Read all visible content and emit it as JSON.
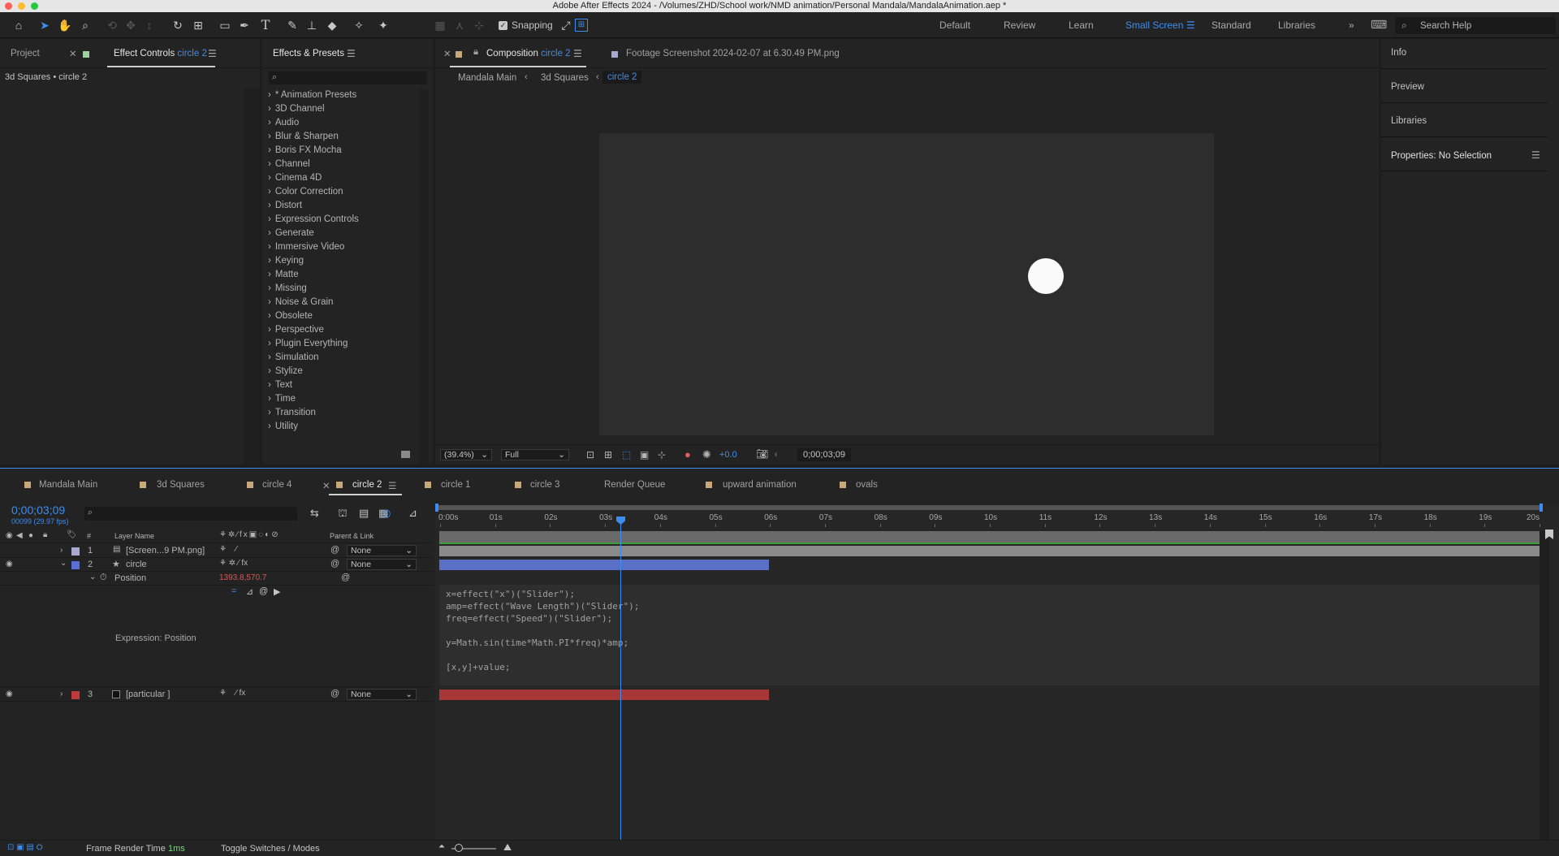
{
  "window": {
    "title": "Adobe After Effects 2024 - /Volumes/ZHD/School work/NMD animation/Personal Mandala/MandalaAnimation.aep *"
  },
  "toolbar": {
    "snapping_label": "Snapping",
    "workspaces": [
      "Default",
      "Review",
      "Learn",
      "Small Screen",
      "Standard",
      "Libraries"
    ],
    "active_workspace": "Small Screen",
    "search_help_placeholder": "Search Help"
  },
  "project_panel": {
    "tab": "Project"
  },
  "effect_controls": {
    "tab_label": "Effect Controls",
    "tab_layer": "circle 2",
    "subtitle": "3d Squares • circle 2"
  },
  "effects_presets": {
    "tab": "Effects & Presets",
    "search_placeholder": "",
    "items": [
      "* Animation Presets",
      "3D Channel",
      "Audio",
      "Blur & Sharpen",
      "Boris FX Mocha",
      "Channel",
      "Cinema 4D",
      "Color Correction",
      "Distort",
      "Expression Controls",
      "Generate",
      "Immersive Video",
      "Keying",
      "Matte",
      "Missing",
      "Noise & Grain",
      "Obsolete",
      "Perspective",
      "Plugin Everything",
      "Simulation",
      "Stylize",
      "Text",
      "Time",
      "Transition",
      "Utility"
    ]
  },
  "composition": {
    "tab_label": "Composition",
    "tab_comp": "circle 2",
    "footage_tab": "Footage Screenshot 2024-02-07 at 6.30.49 PM.png",
    "breadcrumbs": [
      "Mandala Main",
      "3d Squares",
      "circle 2"
    ],
    "zoom": "(39.4%)",
    "resolution": "Full",
    "exposure": "+0.0",
    "timecode": "0;00;03;09"
  },
  "right_panels": {
    "info": "Info",
    "preview": "Preview",
    "libraries": "Libraries",
    "properties": "Properties: No Selection"
  },
  "timeline": {
    "tabs": [
      "Mandala Main",
      "3d Squares",
      "circle 4",
      "circle 2",
      "circle 1",
      "circle 3",
      "Render Queue",
      "upward animation",
      "ovals"
    ],
    "active_tab": "circle 2",
    "current_time": "0;00;03;09",
    "frame_info": "00099 (29.97 fps)",
    "columns": {
      "num": "#",
      "layer_name": "Layer Name",
      "parent": "Parent & Link"
    },
    "ruler": [
      "0:00s",
      "01s",
      "02s",
      "03s",
      "04s",
      "05s",
      "06s",
      "07s",
      "08s",
      "09s",
      "10s",
      "11s",
      "12s",
      "13s",
      "14s",
      "15s",
      "16s",
      "17s",
      "18s",
      "19s",
      "20s"
    ],
    "layers": [
      {
        "num": "1",
        "name": "[Screen...9 PM.png]",
        "parent": "None",
        "color": "#a8a8d0"
      },
      {
        "num": "2",
        "name": "circle",
        "parent": "None",
        "color": "#5a6fd6"
      },
      {
        "num": "3",
        "name": "[particular ]",
        "parent": "None",
        "color": "#c03a3a"
      }
    ],
    "position": {
      "label": "Position",
      "value": "1393.8,570.7"
    },
    "expression_label": "Expression: Position",
    "expression_lines": [
      "x=effect(\"x\")(\"Slider\");",
      "amp=effect(\"Wave Length\")(\"Slider\");",
      "freq=effect(\"Speed\")(\"Slider\");",
      "",
      "y=Math.sin(time*Math.PI*freq)*amp;",
      "",
      "[x,y]+value;"
    ]
  },
  "statusbar": {
    "frame_render_label": "Frame Render Time",
    "frame_render_value": "1ms",
    "toggle_label": "Toggle Switches / Modes"
  }
}
